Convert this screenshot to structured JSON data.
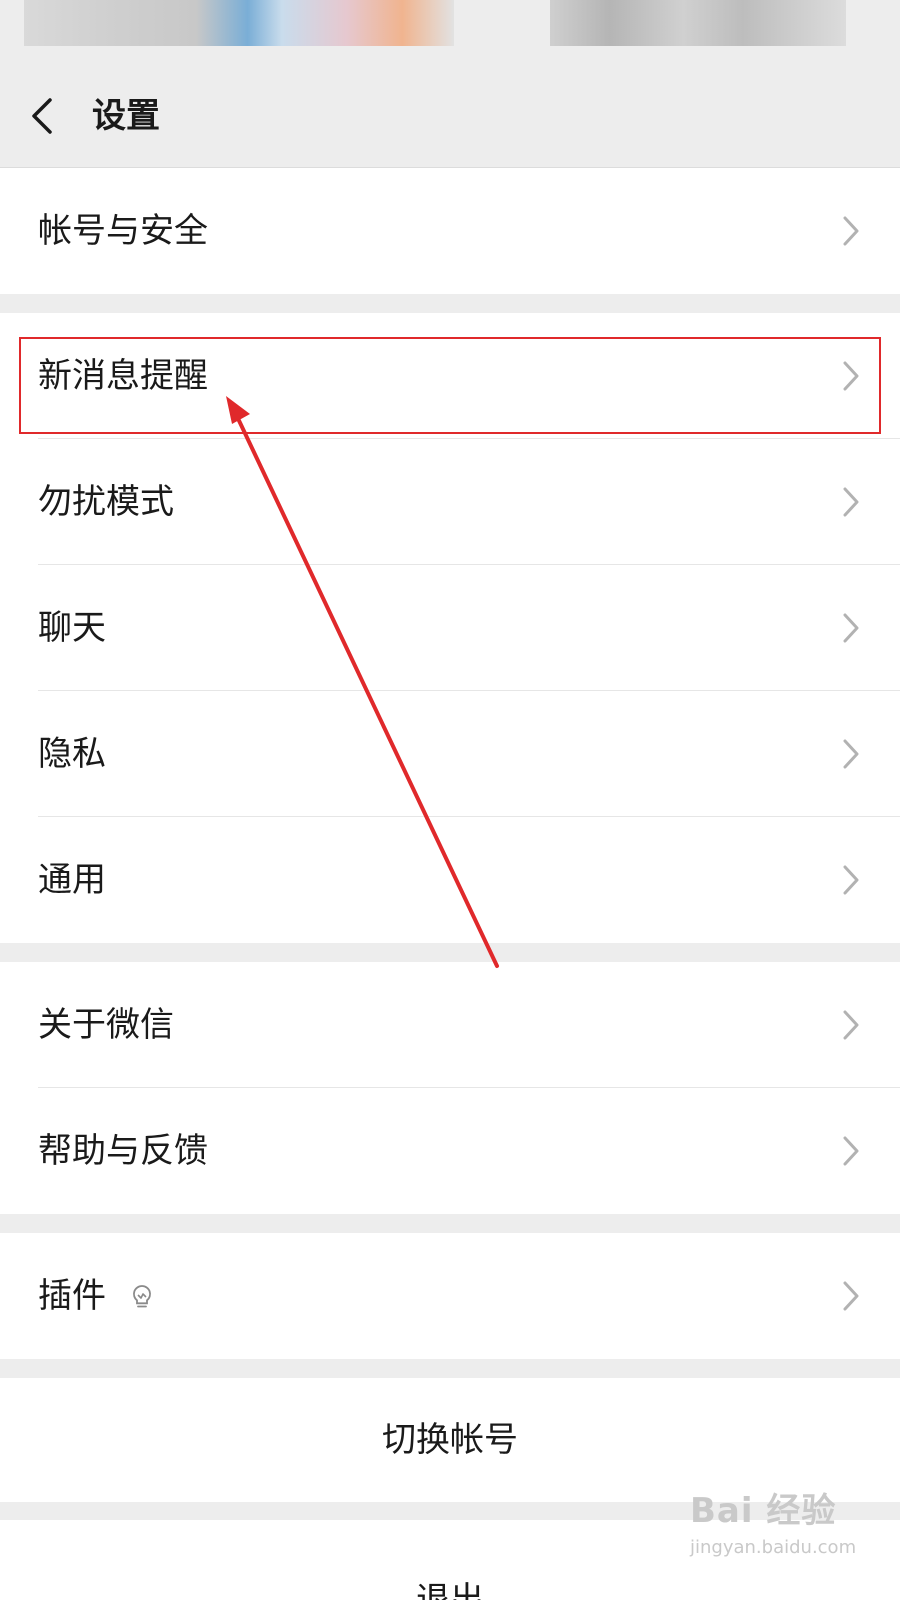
{
  "header": {
    "title": "设置",
    "back_icon": "chevron-left-icon"
  },
  "groups": [
    {
      "items": [
        {
          "label": "帐号与安全"
        }
      ]
    },
    {
      "items": [
        {
          "label": "新消息提醒"
        },
        {
          "label": "勿扰模式"
        },
        {
          "label": "聊天"
        },
        {
          "label": "隐私"
        },
        {
          "label": "通用"
        }
      ]
    },
    {
      "items": [
        {
          "label": "关于微信"
        },
        {
          "label": "帮助与反馈"
        }
      ]
    },
    {
      "items": [
        {
          "label": "插件",
          "badge_icon": "lightbulb-icon"
        }
      ]
    }
  ],
  "actions": {
    "switch_account": "切换帐号",
    "logout": "退出"
  },
  "watermark": {
    "brand": "Bai 经验",
    "site": "jingyan.baidu.com"
  },
  "colors": {
    "background": "#ededed",
    "card": "#ffffff",
    "annotation": "#e0292b",
    "text": "#1a1a1a",
    "chevron": "#b2b2b2"
  }
}
